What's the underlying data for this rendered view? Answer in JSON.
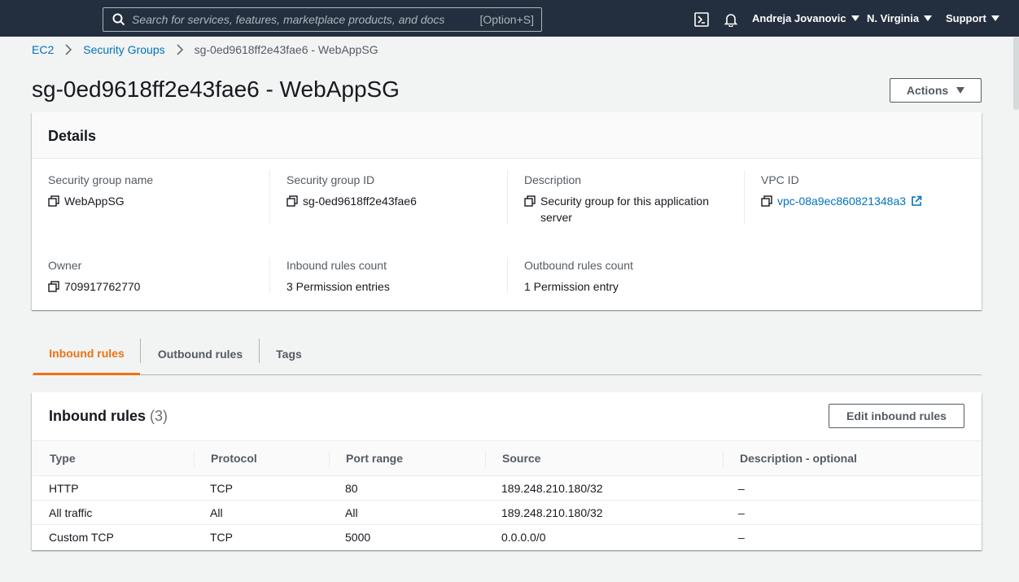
{
  "nav": {
    "search_placeholder": "Search for services, features, marketplace products, and docs",
    "search_shortcut": "[Option+S]",
    "user": "Andreja Jovanovic",
    "region": "N. Virginia",
    "support": "Support"
  },
  "breadcrumb": [
    "EC2",
    "Security Groups",
    "sg-0ed9618ff2e43fae6 - WebAppSG"
  ],
  "page_title": "sg-0ed9618ff2e43fae6 - WebAppSG",
  "actions_label": "Actions",
  "details": {
    "title": "Details",
    "fields": [
      {
        "label": "Security group name",
        "value": "WebAppSG"
      },
      {
        "label": "Security group ID",
        "value": "sg-0ed9618ff2e43fae6"
      },
      {
        "label": "Description",
        "value": "Security group for this application server"
      },
      {
        "label": "VPC ID",
        "value": "vpc-08a9ec860821348a3"
      },
      {
        "label": "Owner",
        "value": "709917762770"
      },
      {
        "label": "Inbound rules count",
        "value": "3 Permission entries"
      },
      {
        "label": "Outbound rules count",
        "value": "1 Permission entry"
      }
    ]
  },
  "tabs": [
    "Inbound rules",
    "Outbound rules",
    "Tags"
  ],
  "inbound": {
    "title": "Inbound rules",
    "count": "(3)",
    "edit_label": "Edit inbound rules",
    "columns": [
      "Type",
      "Protocol",
      "Port range",
      "Source",
      "Description - optional"
    ],
    "rows": [
      [
        "HTTP",
        "TCP",
        "80",
        "189.248.210.180/32",
        "–"
      ],
      [
        "All traffic",
        "All",
        "All",
        "189.248.210.180/32",
        "–"
      ],
      [
        "Custom TCP",
        "TCP",
        "5000",
        "0.0.0.0/0",
        "–"
      ]
    ]
  },
  "colors": {
    "nav_bg": "#232f3e",
    "link": "#0073bb",
    "active_tab": "#ec7211"
  }
}
